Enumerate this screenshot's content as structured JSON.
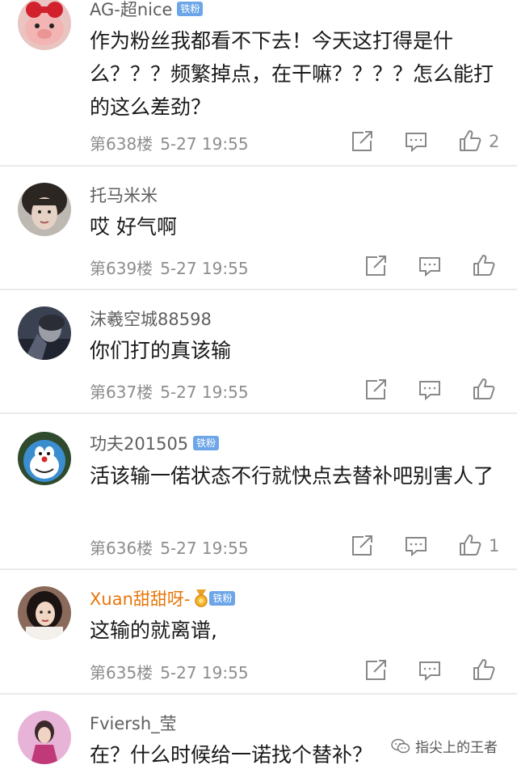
{
  "comments": [
    {
      "username": "AG-超nice",
      "badge": "铁粉",
      "text": "作为粉丝我都看不下去！今天这打得是什么？？？频繁掉点，在干嘛？？？？怎么能打的这么差劲？",
      "floor": "第638楼",
      "time": "5-27 19:55",
      "likes": "2"
    },
    {
      "username": "托马米米",
      "text": "哎 好气啊",
      "floor": "第639楼",
      "time": "5-27 19:55"
    },
    {
      "username": "沫羲空城88598",
      "text": "你们打的真该输",
      "floor": "第637楼",
      "time": "5-27 19:55"
    },
    {
      "username": "功夫201505",
      "badge": "铁粉",
      "text": "活该输一偌状态不行就快点去替补吧别害人了",
      "floor": "第636楼",
      "time": "5-27 19:55",
      "likes": "1"
    },
    {
      "username": "Xuan甜甜呀-",
      "badge": "铁粉",
      "text": "这输的就离谱,",
      "floor": "第635楼",
      "time": "5-27 19:55"
    },
    {
      "username": "Fviersh_莹",
      "text": "在？什么时候给一诺找个替补？"
    }
  ],
  "watermark": "指尖上的王者",
  "colors": {
    "username": "#5f5f5f",
    "vip_username": "#e8760a",
    "badge_bg": "#6da6e8",
    "meta": "#8d8d8d",
    "divider": "#eaeaea"
  },
  "icons": [
    "share-icon",
    "comment-icon",
    "like-icon",
    "medal-icon",
    "wechat-icon"
  ]
}
